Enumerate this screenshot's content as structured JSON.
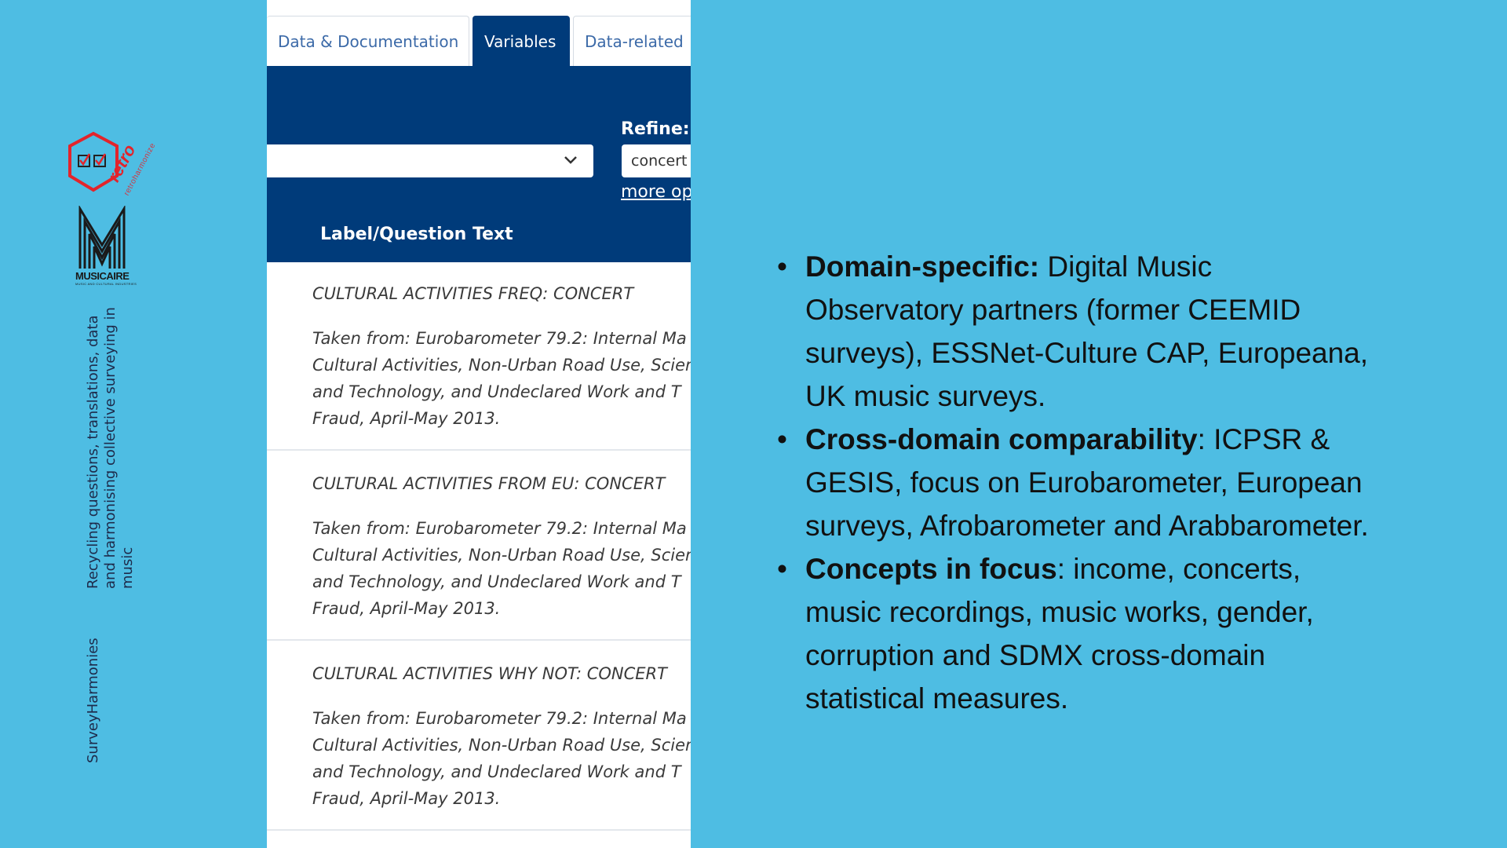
{
  "sidebar": {
    "logo_retro_word": "retro",
    "logo_retro_sub": "retroharmonize",
    "logo_m_name": "MUSICAIRE",
    "logo_m_sub": "MUSIC AND CULTURAL INDUSTRIES",
    "tagline": "Recycling questions, translations, data and harmonising collective surveying in music",
    "brand": "SurveyHarmonies"
  },
  "screenshot": {
    "tabs": [
      {
        "label": "Data & Documentation",
        "active": false
      },
      {
        "label": "Variables",
        "active": true
      },
      {
        "label": "Data-related",
        "active": false
      }
    ],
    "refine_label": "Refine:",
    "refine_value": "concert",
    "more_options": "more op",
    "column_header": "Label/Question Text",
    "results": [
      {
        "title": "CULTURAL ACTIVITIES FREQ: CONCERT",
        "desc": [
          "Taken from: Eurobarometer 79.2: Internal Ma",
          "Cultural Activities, Non-Urban Road Use, Scien",
          "and Technology, and Undeclared Work and T",
          "Fraud, April-May 2013."
        ]
      },
      {
        "title": "CULTURAL ACTIVITIES FROM EU: CONCERT",
        "desc": [
          "Taken from: Eurobarometer 79.2: Internal Ma",
          "Cultural Activities, Non-Urban Road Use, Scien",
          "and Technology, and Undeclared Work and T",
          "Fraud, April-May 2013."
        ]
      },
      {
        "title": "CULTURAL ACTIVITIES WHY NOT: CONCERT",
        "desc": [
          "Taken from: Eurobarometer 79.2: Internal Ma",
          "Cultural Activities, Non-Urban Road Use, Scien",
          "and Technology, and Undeclared Work and T",
          "Fraud, April-May 2013."
        ]
      }
    ]
  },
  "bullets": [
    {
      "bold": "Domain-specific:",
      "text": " Digital Music Observatory partners (former CEEMID surveys), ESSNet-Culture CAP, Europeana, UK music surveys."
    },
    {
      "bold": "Cross-domain comparability",
      "text": ": ICPSR & GESIS, focus on Eurobarometer, European surveys, Afrobarometer and Arabbarometer."
    },
    {
      "bold": "Concepts in focus",
      "text": ": income, concerts, music recordings, music works, gender, corruption and SDMX cross-domain statistical measures."
    }
  ],
  "colors": {
    "background": "#4ebde3",
    "panel": "#003b7a",
    "logo_red": "#e3242b"
  }
}
